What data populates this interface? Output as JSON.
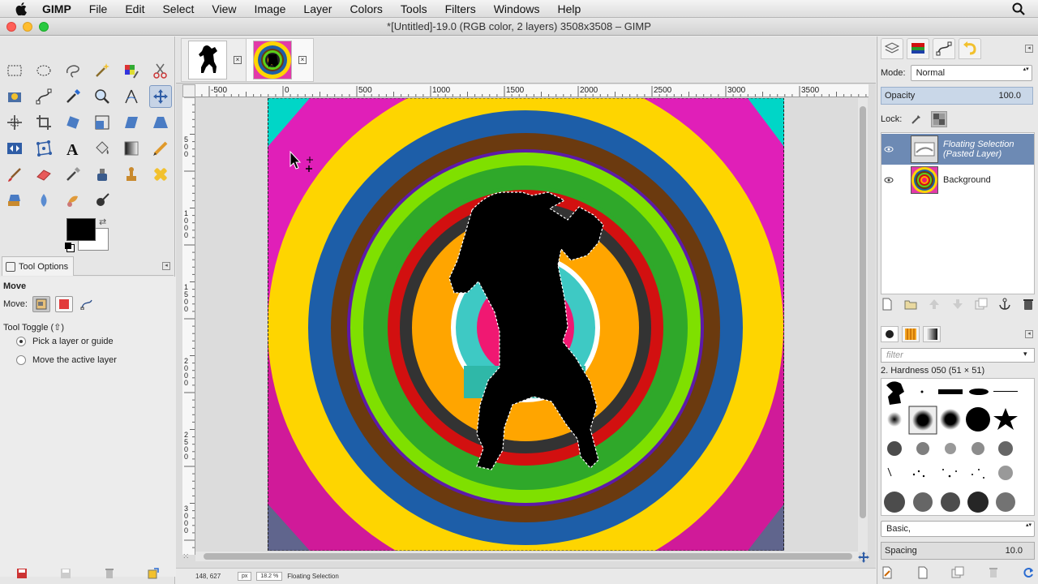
{
  "menubar": {
    "app_name": "GIMP",
    "items": [
      "File",
      "Edit",
      "Select",
      "View",
      "Image",
      "Layer",
      "Colors",
      "Tools",
      "Filters",
      "Windows",
      "Help"
    ]
  },
  "window": {
    "title": "*[Untitled]-19.0 (RGB color, 2 layers) 3508x3508 – GIMP"
  },
  "tool_options": {
    "tab_label": "Tool Options",
    "tool_name": "Move",
    "move_label": "Move:",
    "toggle_label": "Tool Toggle  (⇧)",
    "option_pick": "Pick a layer or guide",
    "option_active": "Move the active layer",
    "selected_option": "pick"
  },
  "rulers": {
    "h_ticks": [
      "-500",
      "0",
      "500",
      "1000",
      "1500",
      "2000",
      "2500",
      "3000",
      "3500"
    ],
    "v_ticks": [
      "5\n0\n0",
      "1\n0\n0\n0",
      "1\n5\n0\n0",
      "2\n0\n0\n0",
      "2\n5\n0\n0",
      "3\n0\n0\n0"
    ]
  },
  "statusbar": {
    "coords": "148, 627",
    "unit": "px",
    "zoom": "18.2 %",
    "message": "Floating Selection"
  },
  "layers_panel": {
    "mode_label": "Mode:",
    "mode_value": "Normal",
    "opacity_label": "Opacity",
    "opacity_value": "100.0",
    "lock_label": "Lock:",
    "layers": [
      {
        "name": "Floating Selection\n(Pasted Layer)",
        "selected": true
      },
      {
        "name": "Background",
        "selected": false
      }
    ]
  },
  "brushes_panel": {
    "filter_placeholder": "filter",
    "brush_name": "2. Hardness 050 (51 × 51)",
    "preset": "Basic,",
    "spacing_label": "Spacing",
    "spacing_value": "10.0"
  },
  "colors": {
    "accent": "#6d8ab4",
    "fg": "#000000",
    "bg": "#ffffff"
  }
}
